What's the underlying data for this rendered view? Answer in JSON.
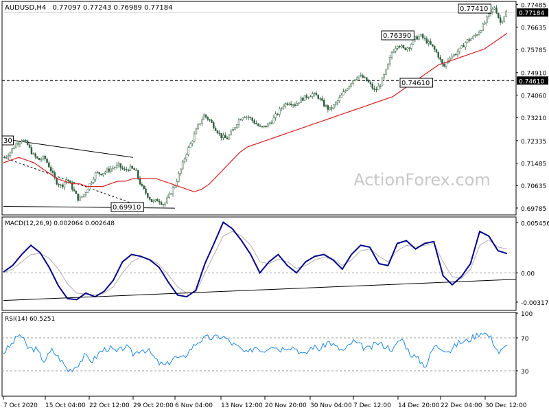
{
  "header": {
    "symbol": "AUDUSD,H4",
    "ohlc": "0.77097 0.77243 0.76989 0.77184"
  },
  "watermark": "ActionForex.com",
  "colors": {
    "candle": "#2f5f3f",
    "ema": "#d62020",
    "macd": "#00008b",
    "signal": "#b0b0b0",
    "rsi": "#1e88e5",
    "price_box": "#000000"
  },
  "chart_data": [
    {
      "type": "candlestick",
      "panel": "price",
      "ylim": [
        0.6955,
        0.7758
      ],
      "y_ticks": [
        "0.77485",
        "0.76635",
        "0.75785",
        "0.74910",
        "0.74060",
        "0.73210",
        "0.72335",
        "0.71485",
        "0.70635",
        "0.69785"
      ],
      "x_ticks": [
        "7 Oct 2020",
        "15 Oct 04:00",
        "22 Oct 12:00",
        "29 Oct 20:00",
        "6 Nov 04:00",
        "13 Nov 12:00",
        "20 Nov 20:00",
        "30 Nov 04:00",
        "7 Dec 12:00",
        "14 Dec 20:00",
        "22 Dec 04:00",
        "30 Dec 12:00"
      ],
      "current_price_label": "0.77184",
      "horizontal_line": {
        "value": 0.7461,
        "label": "0.74610"
      },
      "annotations": [
        {
          "text": "0.77410",
          "value": 0.7741
        },
        {
          "text": "0.76390",
          "value": 0.7639
        },
        {
          "text": "0.74610",
          "value": 0.7461
        },
        {
          "text": "0.69910",
          "value": 0.6991
        },
        {
          "text": "30",
          "value": 0.7235
        }
      ],
      "close_path": [
        0.717,
        0.719,
        0.722,
        0.724,
        0.722,
        0.718,
        0.716,
        0.717,
        0.713,
        0.708,
        0.706,
        0.709,
        0.705,
        0.701,
        0.703,
        0.707,
        0.711,
        0.711,
        0.712,
        0.713,
        0.714,
        0.712,
        0.713,
        0.712,
        0.706,
        0.703,
        0.7,
        0.701,
        0.699,
        0.703,
        0.707,
        0.713,
        0.719,
        0.724,
        0.729,
        0.733,
        0.731,
        0.728,
        0.725,
        0.724,
        0.727,
        0.731,
        0.733,
        0.732,
        0.73,
        0.728,
        0.729,
        0.731,
        0.734,
        0.737,
        0.738,
        0.737,
        0.739,
        0.74,
        0.741,
        0.74,
        0.737,
        0.735,
        0.737,
        0.74,
        0.743,
        0.746,
        0.748,
        0.747,
        0.745,
        0.742,
        0.745,
        0.75,
        0.757,
        0.76,
        0.758,
        0.759,
        0.762,
        0.763,
        0.761,
        0.759,
        0.756,
        0.751,
        0.755,
        0.756,
        0.758,
        0.761,
        0.762,
        0.764,
        0.767,
        0.771,
        0.774,
        0.768,
        0.772
      ],
      "ema_path": [
        0.715,
        0.716,
        0.717,
        0.716,
        0.715,
        0.713,
        0.711,
        0.709,
        0.708,
        0.707,
        0.707,
        0.706,
        0.706,
        0.706,
        0.707,
        0.708,
        0.708,
        0.709,
        0.709,
        0.709,
        0.709,
        0.708,
        0.707,
        0.706,
        0.705,
        0.704,
        0.705,
        0.707,
        0.71,
        0.713,
        0.716,
        0.719,
        0.721,
        0.722,
        0.723,
        0.724,
        0.725,
        0.726,
        0.727,
        0.728,
        0.729,
        0.73,
        0.731,
        0.732,
        0.733,
        0.734,
        0.735,
        0.736,
        0.737,
        0.738,
        0.739,
        0.74,
        0.742,
        0.744,
        0.746,
        0.748,
        0.75,
        0.752,
        0.753,
        0.754,
        0.755,
        0.756,
        0.757,
        0.758,
        0.76,
        0.762,
        0.764
      ],
      "trendlines": [
        {
          "from": [
            "7 Oct 2020",
            0.724
          ],
          "to": [
            "29 Oct 20:00",
            0.717
          ]
        },
        {
          "from": [
            "7 Oct 2020",
            0.717
          ],
          "to": [
            "29 Oct 20:00",
            0.6995
          ]
        },
        {
          "from": [
            "7 Oct 2020",
            0.6985
          ],
          "to": [
            "6 Nov 04:00",
            0.6978
          ]
        }
      ]
    },
    {
      "type": "line",
      "panel": "macd",
      "title": "MACD(12,26,9) 0.002064 0.002648",
      "ylim": [
        -0.004,
        0.006
      ],
      "y_ticks": [
        "0.005456",
        "0.00",
        "-0.003178"
      ],
      "series": [
        {
          "name": "MACD",
          "values": [
            0.0001,
            0.0008,
            0.002,
            0.003,
            0.0022,
            0.0006,
            -0.0014,
            -0.0028,
            -0.0029,
            -0.0022,
            -0.0026,
            -0.002,
            -0.0008,
            0.0012,
            0.002,
            0.0018,
            0.0014,
            0.0006,
            -0.001,
            -0.0024,
            -0.0026,
            -0.0019,
            0.001,
            0.0032,
            0.0055,
            0.0048,
            0.0035,
            0.002,
            0.0,
            0.0012,
            0.002,
            0.0008,
            0.0,
            0.0012,
            0.0018,
            0.002,
            0.0014,
            0.0004,
            0.002,
            0.003,
            0.0028,
            0.001,
            0.0008,
            0.0032,
            0.0035,
            0.0026,
            0.0032,
            0.0034,
            -0.0003,
            -0.0013,
            -0.0004,
            0.001,
            0.0045,
            0.004,
            0.0024,
            0.0021
          ]
        },
        {
          "name": "Signal",
          "values": [
            0.0,
            0.0004,
            0.0012,
            0.002,
            0.0021,
            0.0016,
            0.0004,
            -0.0012,
            -0.0022,
            -0.0023,
            -0.0024,
            -0.0022,
            -0.0015,
            0.0,
            0.0012,
            0.0017,
            0.0015,
            0.0009,
            -0.0002,
            -0.0015,
            -0.0022,
            -0.0021,
            0.0,
            0.002,
            0.004,
            0.0045,
            0.004,
            0.003,
            0.0012,
            0.001,
            0.0015,
            0.0012,
            0.0005,
            0.0008,
            0.0014,
            0.0017,
            0.0015,
            0.0008,
            0.0014,
            0.0024,
            0.0026,
            0.0018,
            0.0012,
            0.0024,
            0.003,
            0.0028,
            0.003,
            0.0032,
            0.0012,
            -0.0004,
            -0.0006,
            0.0004,
            0.003,
            0.0036,
            0.0028,
            0.0026
          ]
        }
      ],
      "trendline": {
        "from": [
          "7 Oct 2020",
          -0.003
        ],
        "to": [
          "30 Dec 12:00",
          -0.0007
        ]
      }
    },
    {
      "type": "line",
      "panel": "rsi",
      "title": "RSI(14) 60.5251",
      "ylim": [
        0,
        100
      ],
      "y_ticks": [
        "100",
        "70",
        "30",
        "0"
      ],
      "levels": [
        70,
        30
      ],
      "series": [
        {
          "name": "RSI(14)",
          "values": [
            52,
            62,
            75,
            58,
            56,
            42,
            55,
            44,
            30,
            36,
            48,
            42,
            54,
            58,
            52,
            60,
            50,
            57,
            53,
            40,
            36,
            47,
            44,
            56,
            66,
            70,
            70,
            72,
            64,
            58,
            50,
            60,
            54,
            62,
            56,
            60,
            58,
            48,
            60,
            56,
            66,
            58,
            54,
            66,
            60,
            56,
            64,
            60,
            56,
            70,
            52,
            44,
            36,
            60,
            58,
            54,
            64,
            66,
            72,
            78,
            70,
            52,
            60
          ]
        }
      ]
    }
  ]
}
